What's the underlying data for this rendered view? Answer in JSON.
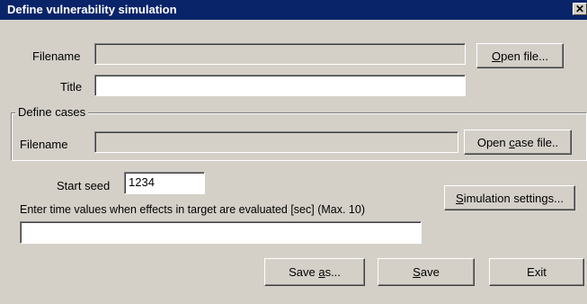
{
  "window": {
    "title": "Define vulnerability simulation",
    "close_glyph": "✕"
  },
  "file": {
    "filename_label": "Filename",
    "filename_value": "",
    "open_button": {
      "underlined": "O",
      "rest": "pen file..."
    },
    "title_label": "Title",
    "title_value": ""
  },
  "cases": {
    "group_label": "Define cases",
    "filename_label": "Filename",
    "filename_value": "",
    "open_button": {
      "pre": "Open ",
      "underlined": "c",
      "rest": "ase file.."
    }
  },
  "simulation": {
    "seed_label": "Start seed",
    "seed_value": "1234",
    "settings_button": {
      "underlined": "S",
      "rest": "imulation settings..."
    },
    "time_label": "Enter time values when effects in target are evaluated [sec] (Max. 10)",
    "time_value": ""
  },
  "footer": {
    "save_as_button": {
      "pre": "Save ",
      "underlined": "a",
      "rest": "s..."
    },
    "save_button": {
      "underlined": "S",
      "rest": "ave"
    },
    "exit_button": "Exit"
  }
}
